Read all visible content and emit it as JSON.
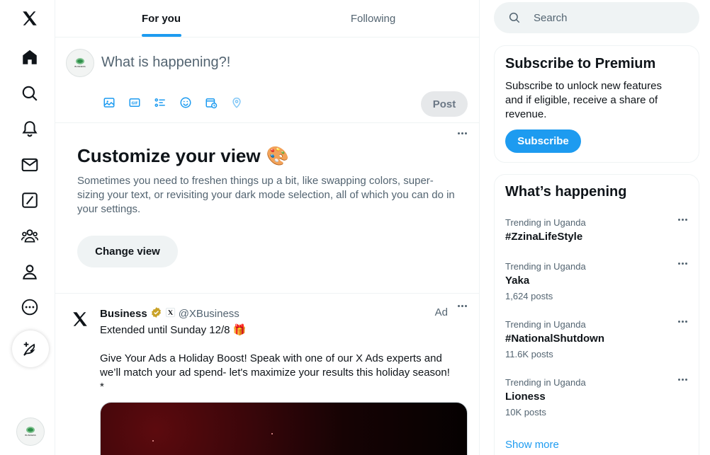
{
  "nav": {
    "items": [
      "x-logo",
      "home",
      "explore",
      "notifications",
      "messages",
      "grok",
      "communities",
      "profile",
      "more"
    ],
    "compose_label": "Post"
  },
  "avatar_logo_text": "BUSINESS",
  "tabs": [
    {
      "label": "For you",
      "active": true
    },
    {
      "label": "Following",
      "active": false
    }
  ],
  "composer": {
    "placeholder": "What is happening?!",
    "post_label": "Post"
  },
  "customize": {
    "title": "Customize your view",
    "emoji": "🎨",
    "description": "Sometimes you need to freshen things up a bit, like swapping colors, super-sizing your text, or revisiting your dark mode selection, all of which you can do in your settings.",
    "button": "Change view"
  },
  "ad": {
    "name": "Business",
    "handle": "@XBusiness",
    "ad_label": "Ad",
    "line1": "Extended until Sunday 12/8 🎁",
    "line2": "Give Your Ads a Holiday Boost! Speak with one of our X Ads experts and we’ll match your ad spend- let's maximize your results this holiday season!",
    "line3": "*"
  },
  "search": {
    "placeholder": "Search"
  },
  "premium": {
    "title": "Subscribe to Premium",
    "text": "Subscribe to unlock new features and if eligible, receive a share of revenue.",
    "button": "Subscribe"
  },
  "trends": {
    "title": "What’s happening",
    "items": [
      {
        "context": "Trending in Uganda",
        "topic": "#ZzinaLifeStyle",
        "count": ""
      },
      {
        "context": "Trending in Uganda",
        "topic": "Yaka",
        "count": "1,624 posts"
      },
      {
        "context": "Trending in Uganda",
        "topic": "#NationalShutdown",
        "count": "11.6K posts"
      },
      {
        "context": "Trending in Uganda",
        "topic": "Lioness",
        "count": "10K posts"
      }
    ],
    "show_more": "Show more"
  },
  "colors": {
    "accent": "#1d9bf0",
    "text": "#0f1419",
    "secondary": "#536471"
  }
}
